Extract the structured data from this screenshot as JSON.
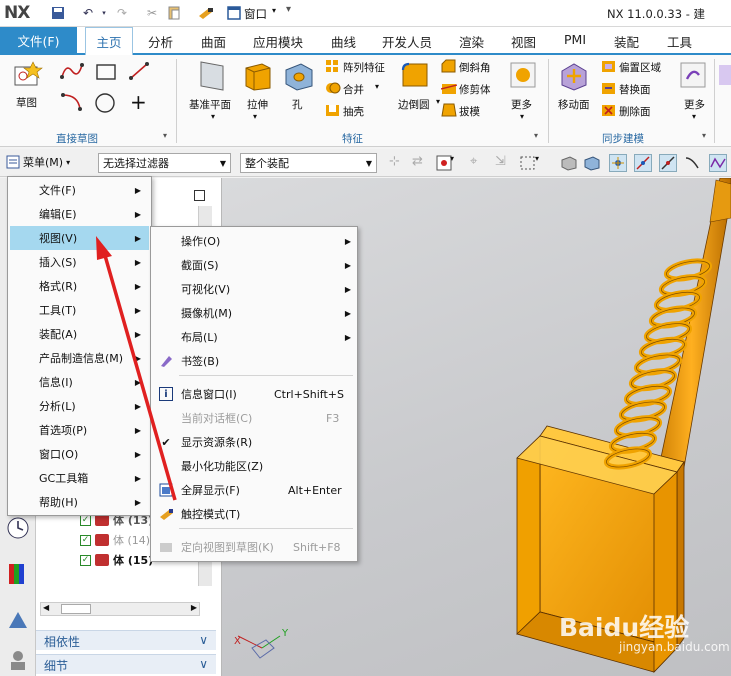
{
  "app": {
    "logo": "NX",
    "window_menu": "窗口",
    "title": "NX 11.0.0.33 - 建"
  },
  "tabs": {
    "file": "文件(F)",
    "items": [
      "主页",
      "分析",
      "曲面",
      "应用模块",
      "曲线",
      "开发人员",
      "渲染",
      "视图",
      "PMI",
      "装配",
      "工具"
    ]
  },
  "ribbon": {
    "sketch": "草图",
    "group_direct_sketch": "直接草图",
    "datum_plane": "基准平面",
    "extrude": "拉伸",
    "hole": "孔",
    "pattern_feature": "阵列特征",
    "unite": "合并",
    "shell": "抽壳",
    "edge_blend": "边倒圆",
    "chamfer": "倒斜角",
    "trim_body": "修剪体",
    "draft": "拔模",
    "more": "更多",
    "group_feature": "特征",
    "move_face": "移动面",
    "offset_region": "偏置区域",
    "replace_face": "替换面",
    "delete_face": "删除面",
    "more2": "更多",
    "group_sync": "同步建模"
  },
  "toolbar2": {
    "menu_button": "菜单(M)",
    "filter": "无选择过滤器",
    "scope": "整个装配"
  },
  "main_menu": {
    "items": [
      {
        "label": "文件(F)",
        "arrow": "▶"
      },
      {
        "label": "编辑(E)",
        "arrow": "▶"
      },
      {
        "label": "视图(V)",
        "arrow": "▶"
      },
      {
        "label": "插入(S)",
        "arrow": "▶"
      },
      {
        "label": "格式(R)",
        "arrow": "▶"
      },
      {
        "label": "工具(T)",
        "arrow": "▶"
      },
      {
        "label": "装配(A)",
        "arrow": "▶"
      },
      {
        "label": "产品制造信息(M)",
        "arrow": "▶"
      },
      {
        "label": "信息(I)",
        "arrow": "▶"
      },
      {
        "label": "分析(L)",
        "arrow": "▶"
      },
      {
        "label": "首选项(P)",
        "arrow": "▶"
      },
      {
        "label": "窗口(O)",
        "arrow": "▶"
      },
      {
        "label": "GC工具箱",
        "arrow": "▶"
      },
      {
        "label": "帮助(H)",
        "arrow": "▶"
      }
    ]
  },
  "view_menu": {
    "operation": "操作(O)",
    "section": "截面(S)",
    "visualization": "可视化(V)",
    "camera": "摄像机(M)",
    "layout": "布局(L)",
    "bookmark": "书签(B)",
    "info_window": "信息窗口(I)",
    "info_window_sc": "Ctrl+Shift+S",
    "current_dialog": "当前对话框(C)",
    "current_dialog_sc": "F3",
    "show_resource_bar": "显示资源条(R)",
    "minimize_ribbon": "最小化功能区(Z)",
    "full_screen": "全屏显示(F)",
    "full_screen_sc": "Alt+Enter",
    "touch_mode": "触控模式(T)",
    "orient_to_sketch": "定向视图到草图(K)",
    "orient_to_sketch_sc": "Shift+F8"
  },
  "navigator": {
    "rows": [
      {
        "label": "体 (13)",
        "checked": true
      },
      {
        "label": "体 (14)",
        "checked": true
      },
      {
        "label": "体 (15)",
        "checked": true
      }
    ],
    "dependencies": "相依性",
    "details": "细节"
  },
  "viewport": {
    "axis_x": "X",
    "axis_y": "Y"
  },
  "watermark": {
    "brand": "Baidu经验",
    "url": "jingyan.baidu.com"
  },
  "colors": {
    "accent": "#2e8bc9",
    "menu_highlight": "#a5d8ef",
    "model_orange": "#f0a300",
    "arrow_red": "#e02020"
  }
}
